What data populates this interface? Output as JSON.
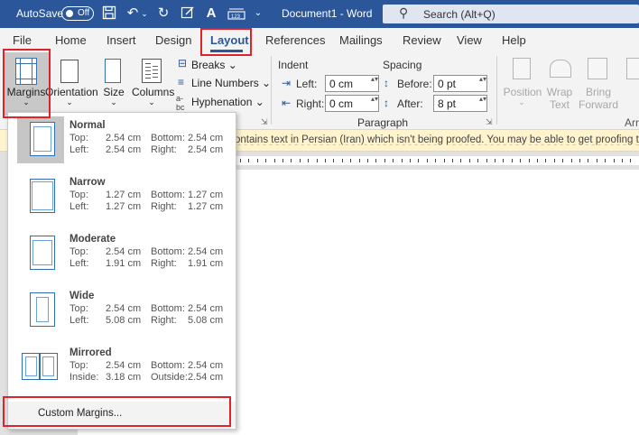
{
  "titlebar": {
    "autosave_label": "AutoSave",
    "autosave_state": "Off",
    "doc_title": "Document1 - Word",
    "search_placeholder": "Search (Alt+Q)"
  },
  "menu": [
    {
      "label": "File"
    },
    {
      "label": "Home"
    },
    {
      "label": "Insert"
    },
    {
      "label": "Design"
    },
    {
      "label": "Layout",
      "active": true
    },
    {
      "label": "References"
    },
    {
      "label": "Mailings"
    },
    {
      "label": "Review"
    },
    {
      "label": "View"
    },
    {
      "label": "Help"
    }
  ],
  "ribbon": {
    "margins": "Margins",
    "orientation": "Orientation",
    "size": "Size",
    "columns": "Columns",
    "breaks": "Breaks",
    "line_numbers": "Line Numbers",
    "hyphenation": "Hyphenation",
    "indent_label": "Indent",
    "spacing_label": "Spacing",
    "left_label": "Left:",
    "left_value": "0 cm",
    "right_label": "Right:",
    "right_value": "0 cm",
    "before_label": "Before:",
    "before_value": "0 pt",
    "after_label": "After:",
    "after_value": "8 pt",
    "paragraph_group": "Paragraph",
    "position": "Position",
    "wrap_text": "Wrap Text",
    "bring_forward": "Bring Forward",
    "arrange_partial": "Arra"
  },
  "notification": "ontains text in Persian (Iran) which isn't being proofed. You may be able to get proofing tools fo",
  "margins_menu": {
    "options": [
      {
        "name": "Normal",
        "top_label": "Top:",
        "top": "2.54 cm",
        "bottom_label": "Bottom:",
        "bottom": "2.54 cm",
        "left_label": "Left:",
        "left": "2.54 cm",
        "right_label": "Right:",
        "right": "2.54 cm"
      },
      {
        "name": "Narrow",
        "top_label": "Top:",
        "top": "1.27 cm",
        "bottom_label": "Bottom:",
        "bottom": "1.27 cm",
        "left_label": "Left:",
        "left": "1.27 cm",
        "right_label": "Right:",
        "right": "1.27 cm"
      },
      {
        "name": "Moderate",
        "top_label": "Top:",
        "top": "2.54 cm",
        "bottom_label": "Bottom:",
        "bottom": "2.54 cm",
        "left_label": "Left:",
        "left": "1.91 cm",
        "right_label": "Right:",
        "right": "1.91 cm"
      },
      {
        "name": "Wide",
        "top_label": "Top:",
        "top": "2.54 cm",
        "bottom_label": "Bottom:",
        "bottom": "2.54 cm",
        "left_label": "Left:",
        "left": "5.08 cm",
        "right_label": "Right:",
        "right": "5.08 cm"
      },
      {
        "name": "Mirrored",
        "top_label": "Top:",
        "top": "2.54 cm",
        "bottom_label": "Bottom:",
        "bottom": "2.54 cm",
        "left_label": "Inside:",
        "left": "3.18 cm",
        "right_label": "Outside:",
        "right": "2.54 cm"
      }
    ],
    "custom": "Custom Margins..."
  },
  "colors": {
    "title_bar": "#2b579a",
    "highlight": "#e0232b",
    "notification_bg": "#fff4ce"
  }
}
